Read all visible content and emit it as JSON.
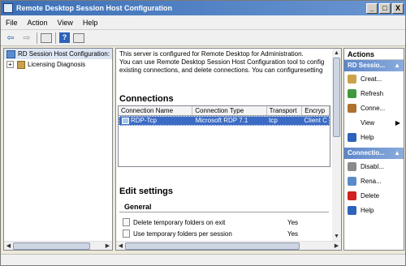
{
  "window": {
    "title": "Remote Desktop Session Host Configuration",
    "buttons": [
      "_",
      "□",
      "X"
    ]
  },
  "menu": [
    "File",
    "Action",
    "View",
    "Help"
  ],
  "toolbar": {
    "back": "⇦",
    "forward": "⇨",
    "help": "?"
  },
  "tree": {
    "root": {
      "label": "RD Session Host Configuration:",
      "expander": ""
    },
    "child": {
      "label": "Licensing Diagnosis",
      "expander": "+"
    }
  },
  "center": {
    "intro": [
      "This server is configured for Remote Desktop for Administration.",
      "You can use Remote Desktop Session Host Configuration tool to config",
      "existing connections, and delete connections. You can configuresetting"
    ],
    "connections_heading": "Connections",
    "columns": [
      "Connection Name",
      "Connection Type",
      "Transport",
      "Encryp"
    ],
    "rows": [
      {
        "name": "RDP-Tcp",
        "type": "Microsoft RDP 7.1",
        "transport": "tcp",
        "encryption": "Client C"
      }
    ],
    "edit_heading": "Edit settings",
    "general_heading": "General",
    "settings": [
      {
        "label": "Delete temporary folders on exit",
        "value": "Yes"
      },
      {
        "label": "Use temporary folders per session",
        "value": "Yes"
      }
    ]
  },
  "actions": {
    "title": "Actions",
    "group1": {
      "title": "RD Sessio...",
      "arrow": "▲"
    },
    "group1_items": [
      {
        "label": "Creat...",
        "icon": "create-connection-icon",
        "color": "#c9a24a"
      },
      {
        "label": "Refresh",
        "icon": "refresh-icon",
        "color": "#3f9a3f"
      },
      {
        "label": "Conne...",
        "icon": "connect-icon",
        "color": "#b07030"
      },
      {
        "label": "View",
        "icon": "none",
        "color": "#ffffff",
        "submenu": "▶"
      },
      {
        "label": "Help",
        "icon": "help-icon",
        "color": "#2d63b9"
      }
    ],
    "group2": {
      "title": "Connectio...",
      "arrow": "▲"
    },
    "group2_items": [
      {
        "label": "Disabl...",
        "icon": "disable-icon",
        "color": "#8a8a8a"
      },
      {
        "label": "Rena...",
        "icon": "rename-icon",
        "color": "#5a8ac8"
      },
      {
        "label": "Delete",
        "icon": "delete-icon",
        "color": "#d02020"
      },
      {
        "label": "Help",
        "icon": "help-icon",
        "color": "#2d63b9"
      }
    ]
  }
}
